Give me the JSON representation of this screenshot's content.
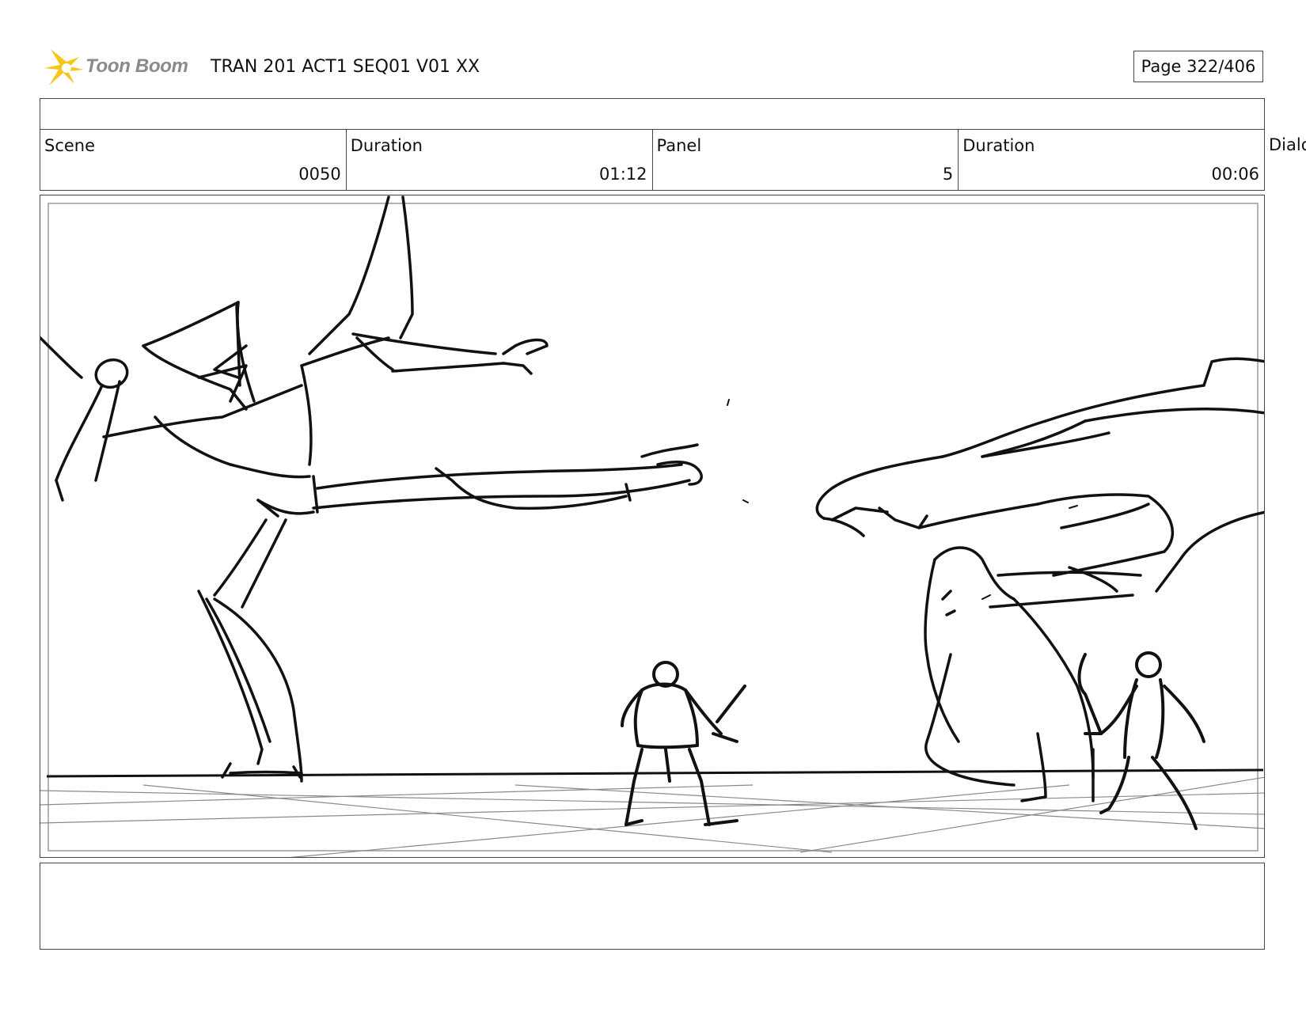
{
  "header": {
    "logo_text": "Toon Boom",
    "title": "TRAN 201 ACT1 SEQ01 V01 XX",
    "page": "Page 322/406"
  },
  "info": {
    "scene_label": "Scene",
    "scene_value": "0050",
    "duration_label": "Duration",
    "duration_value": "01:12",
    "panel_label": "Panel",
    "panel_value": "5",
    "panel_duration_label": "Duration",
    "panel_duration_value": "00:06",
    "dialog_label": "Dialo"
  },
  "colors": {
    "logo_star": "#f5c518",
    "logo_text": "#8a8a8a",
    "ink": "#111111",
    "border": "#444444"
  }
}
